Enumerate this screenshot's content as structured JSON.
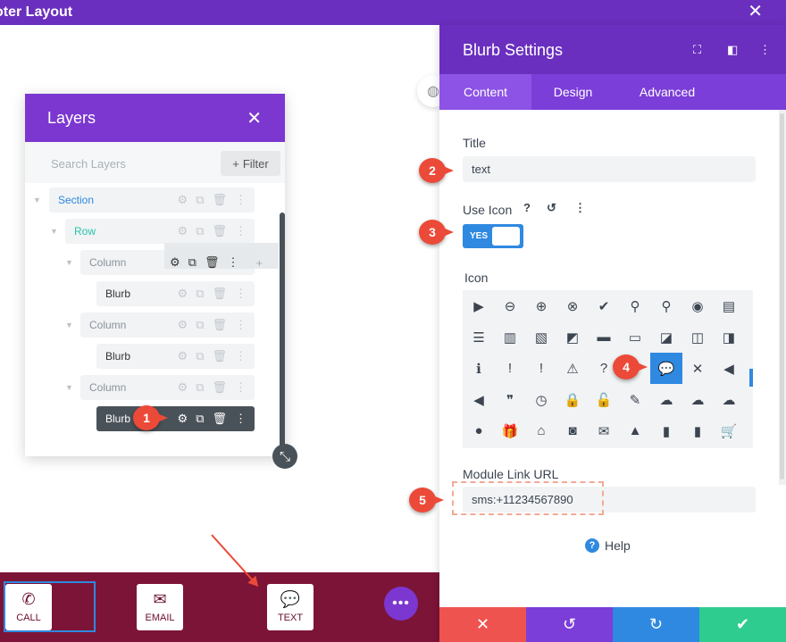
{
  "topbar": {
    "title": "oter Layout",
    "close_glyph": "✕"
  },
  "layers": {
    "title": "Layers",
    "close_glyph": "✕",
    "search_placeholder": "Search Layers",
    "filter_label": "Filter",
    "rows": [
      {
        "label": "Section"
      },
      {
        "label": "Row"
      },
      {
        "label": "Column"
      },
      {
        "label": "Blurb"
      },
      {
        "label": "Column"
      },
      {
        "label": "Blurb"
      },
      {
        "label": "Column"
      },
      {
        "label": "Blurb"
      }
    ]
  },
  "footer_buttons": [
    {
      "label": "CALL",
      "icon": "phone-icon"
    },
    {
      "label": "EMAIL",
      "icon": "envelope-icon"
    },
    {
      "label": "TEXT",
      "icon": "chat-icon"
    }
  ],
  "settings": {
    "title": "Blurb Settings",
    "tabs": [
      "Content",
      "Design",
      "Advanced"
    ],
    "active_tab": "Content",
    "title_label": "Title",
    "title_value": "text",
    "use_icon_label": "Use Icon",
    "use_icon_value": "YES",
    "icon_label": "Icon",
    "selected_icon": "chat-bubbles-icon",
    "module_link_label": "Module Link URL",
    "module_link_value": "sms:+11234567890",
    "help_label": "Help"
  },
  "annotations": [
    "1",
    "2",
    "3",
    "4",
    "5"
  ],
  "colors": {
    "purple_header": "#6a2fbf",
    "layers_header": "#7b37d0",
    "accent_blue": "#2f89e0",
    "footer_maroon": "#7c1438",
    "annotation_red": "#ec4a38",
    "cancel_red": "#ef5350",
    "undo_purple": "#7b3ed8",
    "redo_blue": "#2f89e0",
    "save_green": "#2ecc8f"
  }
}
